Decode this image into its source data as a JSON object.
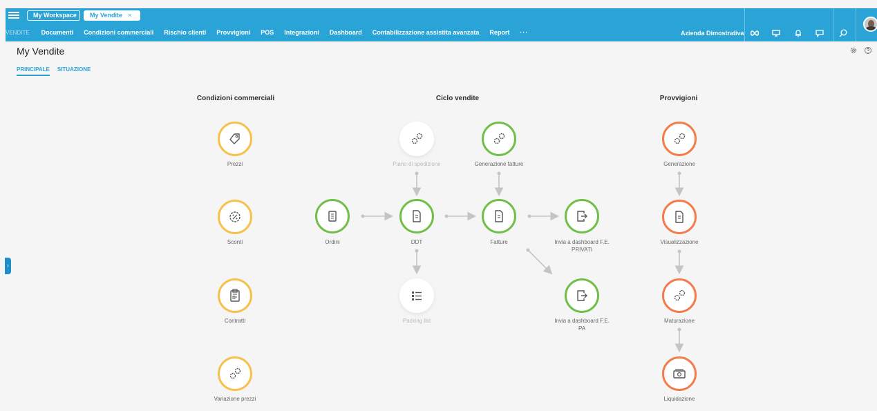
{
  "workspace_tabs": {
    "workspace": "My Workspace",
    "current": "My Vendite",
    "close_symbol": "×"
  },
  "nav": {
    "section": "VENDITE",
    "items": [
      "Documenti",
      "Condizioni commerciali",
      "Rischio clienti",
      "Provvigioni",
      "POS",
      "Integrazioni",
      "Dashboard",
      "Contabilizzazione assistita avanzata",
      "Report"
    ],
    "more": "···"
  },
  "company": "Azienda Dimostrativa",
  "top_icons": [
    "infinity-icon",
    "monitor-icon",
    "bell-icon",
    "chat-icon",
    "search-icon",
    "avatar"
  ],
  "page": {
    "title": "My Vendite",
    "tabs": [
      "PRINCIPALE",
      "SITUAZIONE"
    ],
    "active_tab": "PRINCIPALE"
  },
  "sections": {
    "commercial": "Condizioni commerciali",
    "sales_cycle": "Ciclo vendite",
    "commissions": "Provvigioni"
  },
  "nodes": {
    "prezzi": {
      "label": "Prezzi",
      "icon": "tag-icon",
      "color": "#f7c14e"
    },
    "sconti": {
      "label": "Sconti",
      "icon": "discount-badge-icon",
      "color": "#f7c14e"
    },
    "contratti": {
      "label": "Contratti",
      "icon": "clipboard-icon",
      "color": "#f7c14e"
    },
    "variazione": {
      "label": "Variazione prezzi",
      "icon": "gears-icon",
      "color": "#f7c14e"
    },
    "piano": {
      "label": "Piano di spedizione",
      "icon": "gears-icon",
      "color": "#c9c9c9"
    },
    "generazione_fatture": {
      "label": "Generazione fatture",
      "icon": "gears-icon",
      "color": "#71bf4a"
    },
    "ordini": {
      "label": "Ordini",
      "icon": "receipt-icon",
      "color": "#71bf4a"
    },
    "ddt": {
      "label": "DDT",
      "icon": "document-icon",
      "color": "#71bf4a"
    },
    "fatture": {
      "label": "Fatture",
      "icon": "document-icon",
      "color": "#71bf4a"
    },
    "invia_privati": {
      "label_1": "Invia a dashboard F.E.",
      "label_2": "PRIVATI",
      "icon": "export-icon",
      "color": "#71bf4a"
    },
    "packing": {
      "label": "Packing list",
      "icon": "list-icon",
      "color": "#c9c9c9"
    },
    "invia_pa": {
      "label_1": "Invia a dashboard F.E.",
      "label_2": "PA",
      "icon": "export-icon",
      "color": "#71bf4a"
    },
    "generazione": {
      "label": "Generazione",
      "icon": "gears-icon",
      "color": "#f47b4b"
    },
    "visualizzazione": {
      "label": "Visualizzazione",
      "icon": "document-icon",
      "color": "#f47b4b"
    },
    "maturazione": {
      "label": "Maturazione",
      "icon": "gears-icon",
      "color": "#f47b4b"
    },
    "liquidazione": {
      "label": "Liquidazione",
      "icon": "cash-icon",
      "color": "#f47b4b"
    }
  },
  "colors": {
    "brand_blue": "#2aa4d6",
    "connector_gray": "#c4c4c4"
  }
}
